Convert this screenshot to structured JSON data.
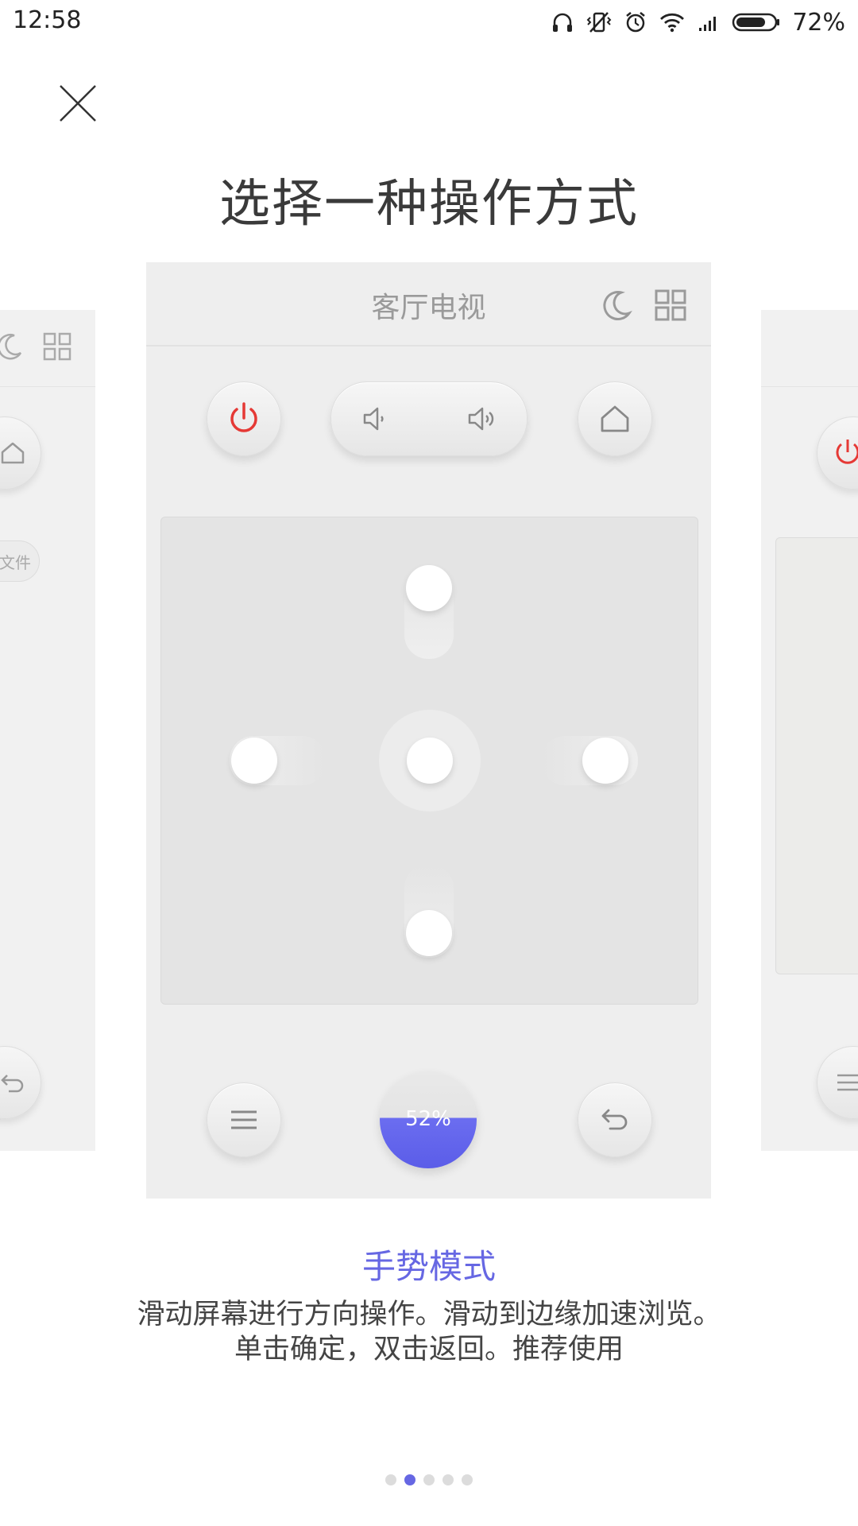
{
  "status_bar": {
    "time": "12:58",
    "battery": "72%"
  },
  "page": {
    "title": "选择一种操作方式"
  },
  "remote_card": {
    "title": "客厅电视",
    "progress_percent": "52%",
    "progress_value": 0.52
  },
  "side_left": {
    "chip_label": "文件"
  },
  "mode": {
    "title": "手势模式",
    "desc_line1": "滑动屏幕进行方向操作。滑动到边缘加速浏览。",
    "desc_line2": "单击确定，双击返回。推荐使用"
  },
  "pagination": {
    "count": 5,
    "active_index": 1
  },
  "colors": {
    "accent": "#6667e3",
    "power_red": "#e53935",
    "card_bg": "#eeeeee"
  }
}
